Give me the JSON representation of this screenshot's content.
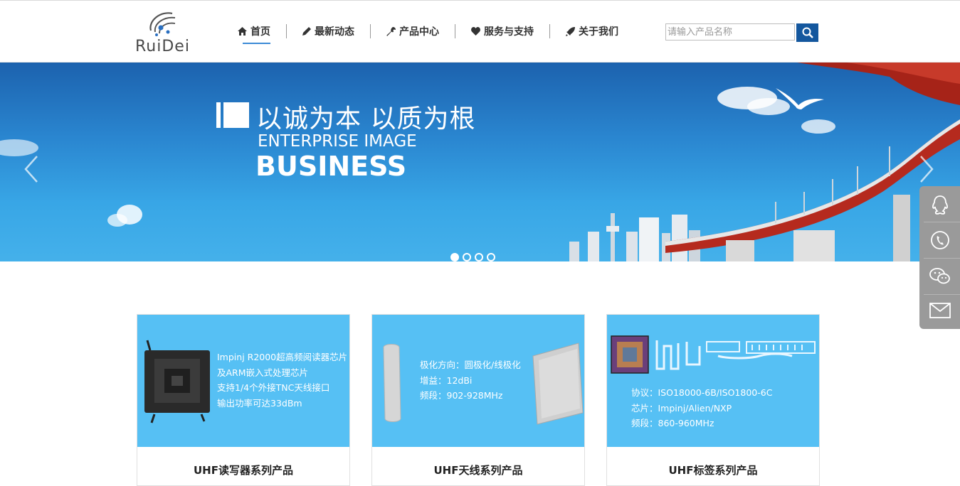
{
  "logo": {
    "text": "RuiDei"
  },
  "nav": {
    "items": [
      {
        "label": "首页",
        "icon": "home-icon"
      },
      {
        "label": "最新动态",
        "icon": "pencil-icon"
      },
      {
        "label": "产品中心",
        "icon": "wrench-icon"
      },
      {
        "label": "服务与支持",
        "icon": "heart-icon"
      },
      {
        "label": "关于我们",
        "icon": "rocket-icon"
      }
    ],
    "active_index": 0
  },
  "search": {
    "placeholder": "请输入产品名称",
    "button_icon": "search-icon"
  },
  "banner": {
    "slogan_cn": "以诚为本 以质为根",
    "slogan_en_line1": "ENTERPRISE IMAGE",
    "slogan_en_line2": "BUSINESS",
    "slide_count": 4,
    "active_slide": 1
  },
  "side_bar": {
    "items": [
      "qq-icon",
      "phone-icon",
      "wechat-icon",
      "mail-icon"
    ]
  },
  "cards": [
    {
      "specs": [
        "Impinj R2000超高频阅读器芯片",
        "及ARM嵌入式处理芯片",
        "支持1/4个外接TNC天线接口",
        "输出功率可达33dBm"
      ],
      "title": "UHF读写器系列产品"
    },
    {
      "specs": [
        "极化方向：圆极化/线极化",
        "增益：12dBi",
        "频段：902-928MHz"
      ],
      "title": "UHF天线系列产品"
    },
    {
      "specs": [
        "协议：ISO18000-6B/ISO1800-6C",
        "芯片：Impinj/Alien/NXP",
        "频段：860-960MHz"
      ],
      "title": "UHF标签系列产品"
    }
  ],
  "colors": {
    "accent": "#3b8ad6",
    "search_button": "#14579e",
    "card_bg": "#56c0f4",
    "side_bar": "#9a9a9a"
  }
}
